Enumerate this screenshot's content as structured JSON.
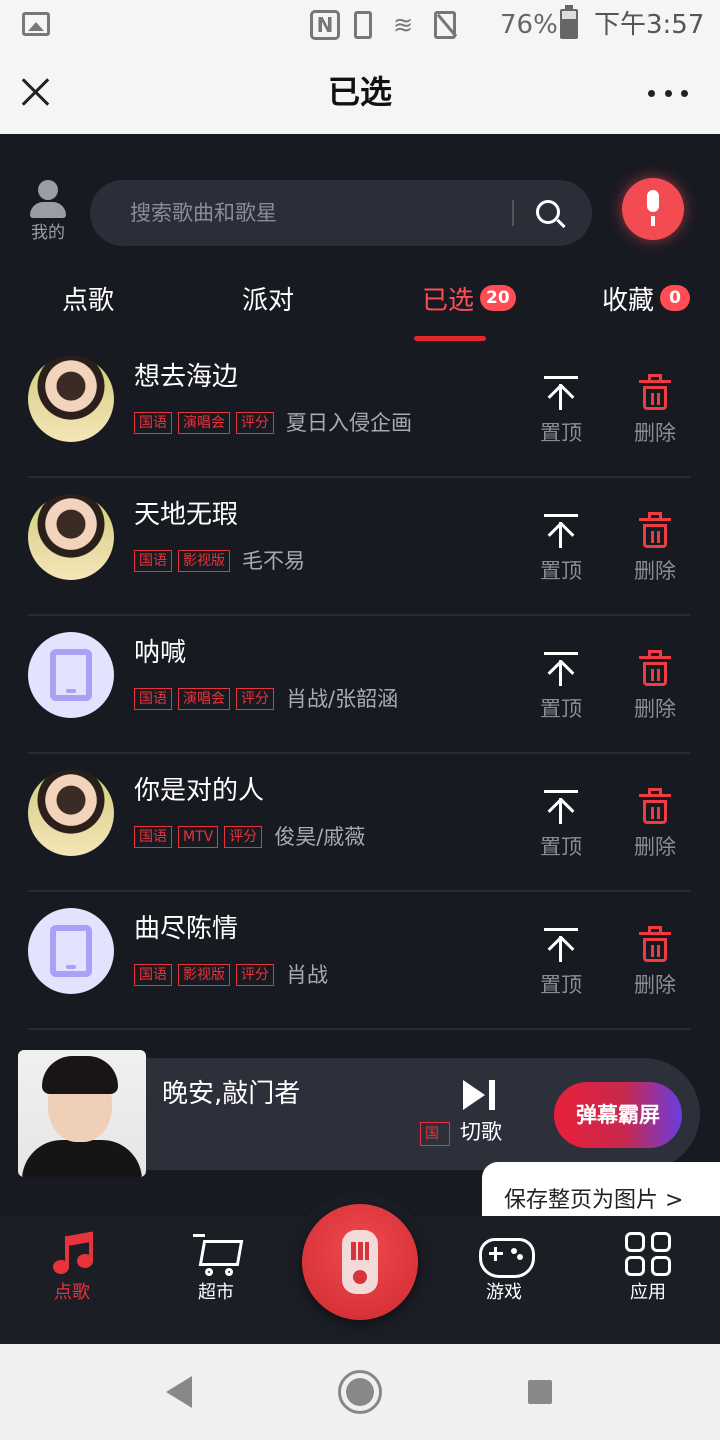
{
  "status_bar": {
    "battery": "76%",
    "time": "下午3:57"
  },
  "header": {
    "title": "已选"
  },
  "search": {
    "placeholder": "搜索歌曲和歌星",
    "mine_label": "我的"
  },
  "tabs": [
    {
      "label": "点歌"
    },
    {
      "label": "派对"
    },
    {
      "label": "已选",
      "badge": "20",
      "active": true
    },
    {
      "label": "收藏",
      "badge": "0"
    }
  ],
  "songs": [
    {
      "title": "想去海边",
      "tags": [
        "国语",
        "演唱会",
        "评分"
      ],
      "singer": "夏日入侵企画",
      "avatar": "photo"
    },
    {
      "title": "天地无瑕",
      "tags": [
        "国语",
        "影视版"
      ],
      "singer": "毛不易",
      "avatar": "photo"
    },
    {
      "title": "呐喊",
      "tags": [
        "国语",
        "演唱会",
        "评分"
      ],
      "singer": "肖战/张韶涵",
      "avatar": "tablet-icon"
    },
    {
      "title": "你是对的人",
      "tags": [
        "国语",
        "MTV",
        "评分"
      ],
      "singer": "俊昊/戚薇",
      "avatar": "photo"
    },
    {
      "title": "曲尽陈情",
      "tags": [
        "国语",
        "影视版",
        "评分"
      ],
      "singer": "肖战",
      "avatar": "tablet-icon"
    }
  ],
  "song_actions": {
    "pin_label": "置顶",
    "delete_label": "删除"
  },
  "player": {
    "title": "晚安,敲门者",
    "tag": "国语",
    "next_label": "切歌",
    "danmu_label": "弹幕霸屏"
  },
  "save_tip": "保存整页为图片 >",
  "bottom_nav": [
    {
      "label": "点歌",
      "icon": "music-note-icon",
      "active": true
    },
    {
      "label": "超市",
      "icon": "cart-icon"
    },
    {
      "label": "游戏",
      "icon": "gamepad-icon"
    },
    {
      "label": "应用",
      "icon": "apps-icon"
    }
  ],
  "colors": {
    "accent": "#e8333c",
    "background": "#181a22"
  }
}
